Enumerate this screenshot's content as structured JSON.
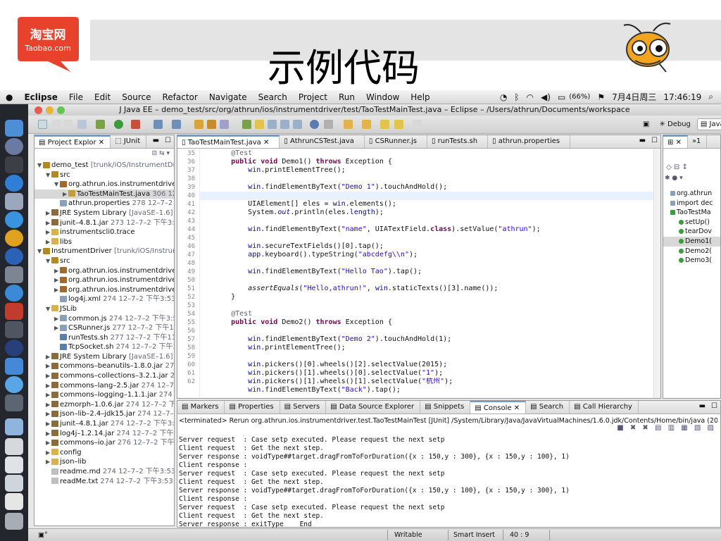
{
  "slide": {
    "title": "示例代码",
    "logo_cn": "淘宝网",
    "logo_en": "Taobao.com",
    "brand_color": "#e8412c"
  },
  "menubar": {
    "app": "Eclipse",
    "items": [
      "File",
      "Edit",
      "Source",
      "Refactor",
      "Navigate",
      "Search",
      "Project",
      "Run",
      "Window",
      "Help"
    ],
    "battery": "(66%)",
    "date": "7月4日周三",
    "time": "17:46:19"
  },
  "window": {
    "title": "J Java EE – demo_test/src/org/athrun/ios/instrumentdriver/test/TaoTestMainTest.java – Eclipse – /Users/athrun/Documents/workspace"
  },
  "perspectives": {
    "debug": "Debug",
    "javaee": "Java EE"
  },
  "explorer": {
    "tabs": [
      "Project Explor",
      "JUnit"
    ],
    "rows": [
      {
        "d": 0,
        "tw": "▼",
        "c": "#b48a1e",
        "t": "demo_test",
        "m": " [trunk/iOS/InstrumentDrive"
      },
      {
        "d": 1,
        "tw": "▼",
        "c": "#b48a1e",
        "t": "src",
        "m": ""
      },
      {
        "d": 2,
        "tw": "▼",
        "c": "#a06a2a",
        "t": "org.athrun.ios.instrumentdriver.t",
        "m": ""
      },
      {
        "d": 3,
        "tw": "▶",
        "c": "#c79b3a",
        "t": "TaoTestMainTest.java",
        "m": " 306  12",
        "sel": true
      },
      {
        "d": 2,
        "tw": "",
        "c": "#8aa0b8",
        "t": "athrun.properties",
        "m": " 278  12–7–2 T"
      },
      {
        "d": 1,
        "tw": "▶",
        "c": "#8b6b3a",
        "t": "JRE System Library",
        "m": " [JavaSE–1.6]"
      },
      {
        "d": 1,
        "tw": "▶",
        "c": "#8b6b3a",
        "t": "junit–4.8.1.jar",
        "m": " 273  12–7–2 下午3:4"
      },
      {
        "d": 1,
        "tw": "▶",
        "c": "#d9b24a",
        "t": "instrumentscli0.trace",
        "m": ""
      },
      {
        "d": 1,
        "tw": "▶",
        "c": "#d9b24a",
        "t": "libs",
        "m": ""
      },
      {
        "d": 0,
        "tw": "▼",
        "c": "#b48a1e",
        "t": "InstrumentDriver",
        "m": " [trunk/iOS/Instrumen"
      },
      {
        "d": 1,
        "tw": "▼",
        "c": "#b48a1e",
        "t": "src",
        "m": ""
      },
      {
        "d": 2,
        "tw": "▶",
        "c": "#a06a2a",
        "t": "org.athrun.ios.instrumentdriver",
        "m": ""
      },
      {
        "d": 2,
        "tw": "▶",
        "c": "#a06a2a",
        "t": "org.athrun.ios.instrumentdriver.c",
        "m": ""
      },
      {
        "d": 2,
        "tw": "▶",
        "c": "#a06a2a",
        "t": "org.athrun.ios.instrumentdriver.t",
        "m": ""
      },
      {
        "d": 2,
        "tw": "",
        "c": "#8aa0b8",
        "t": "log4j.xml",
        "m": " 274  12–7–2 下午3:53"
      },
      {
        "d": 1,
        "tw": "▼",
        "c": "#d9b24a",
        "t": "JSLib",
        "m": ""
      },
      {
        "d": 2,
        "tw": "▶",
        "c": "#8aa0b8",
        "t": "common.js",
        "m": " 274  12–7–2 下午3:5"
      },
      {
        "d": 2,
        "tw": "▶",
        "c": "#8aa0b8",
        "t": "CSRunner.js",
        "m": " 277  12–7–2 下午11"
      },
      {
        "d": 2,
        "tw": "",
        "c": "#5c7fa8",
        "t": "runTests.sh",
        "m": " 277  12–7–2 下午11:"
      },
      {
        "d": 2,
        "tw": "",
        "c": "#5c7fa8",
        "t": "TcpSocket.sh",
        "m": " 274  12–7–2 下午3"
      },
      {
        "d": 1,
        "tw": "▶",
        "c": "#8b6b3a",
        "t": "JRE System Library",
        "m": " [JavaSE–1.6]"
      },
      {
        "d": 1,
        "tw": "▶",
        "c": "#8b6b3a",
        "t": "commons–beanutils–1.8.0.jar",
        "m": " 274"
      },
      {
        "d": 1,
        "tw": "▶",
        "c": "#8b6b3a",
        "t": "commons–collections–3.2.1.jar",
        "m": " 274"
      },
      {
        "d": 1,
        "tw": "▶",
        "c": "#8b6b3a",
        "t": "commons–lang–2.5.jar",
        "m": " 274  12–7–2"
      },
      {
        "d": 1,
        "tw": "▶",
        "c": "#8b6b3a",
        "t": "commons–logging–1.1.1.jar",
        "m": " 274  12"
      },
      {
        "d": 1,
        "tw": "▶",
        "c": "#8b6b3a",
        "t": "ezmorph–1.0.6.jar",
        "m": " 274  12–7–2 下午"
      },
      {
        "d": 1,
        "tw": "▶",
        "c": "#8b6b3a",
        "t": "json–lib–2.4–jdk15.jar",
        "m": " 274  12–7–2"
      },
      {
        "d": 1,
        "tw": "▶",
        "c": "#8b6b3a",
        "t": "junit–4.8.1.jar",
        "m": " 274  12–7–2 下午3:5"
      },
      {
        "d": 1,
        "tw": "▶",
        "c": "#8b6b3a",
        "t": "log4j–1.2.14.jar",
        "m": " 274  12–7–2 下午3"
      },
      {
        "d": 1,
        "tw": "▶",
        "c": "#8b6b3a",
        "t": "commons–io.jar",
        "m": " 276  12–7–2 下午6:"
      },
      {
        "d": 1,
        "tw": "▶",
        "c": "#d9b24a",
        "t": "config",
        "m": ""
      },
      {
        "d": 1,
        "tw": "▶",
        "c": "#d9b24a",
        "t": "json–lib",
        "m": ""
      },
      {
        "d": 1,
        "tw": "",
        "c": "#bfbfbf",
        "t": "readme.md",
        "m": " 274  12–7–2 下午3:53  t"
      },
      {
        "d": 1,
        "tw": "",
        "c": "#bfbfbf",
        "t": "readMe.txt",
        "m": " 274  12–7–2 下午3:53  t"
      }
    ]
  },
  "editor": {
    "tabs": [
      "TaoTestMainTest.java",
      "AthrunCSTest.java",
      "CSRunner.js",
      "runTests.sh",
      "athrun.properties"
    ],
    "line_numbers": [
      "35",
      "36",
      "37",
      "38",
      "39",
      "40",
      "41",
      "42",
      "43",
      "44",
      "45",
      "46",
      "47",
      "48",
      "49",
      "50",
      "51",
      "52",
      "53",
      "54",
      "55",
      "56",
      "57",
      "58",
      "59",
      "60",
      "61",
      "62",
      ""
    ],
    "lines": [
      [
        [
          "an",
          "    @Test"
        ]
      ],
      [
        [
          "kw",
          "    public void "
        ],
        [
          "",
          "Demo1() "
        ],
        [
          "kw",
          "throws "
        ],
        [
          "",
          "Exception {"
        ]
      ],
      [
        [
          "",
          "        "
        ],
        [
          "fd",
          "win"
        ],
        [
          "",
          ".printElementTree();"
        ]
      ],
      [
        [
          "",
          ""
        ]
      ],
      [
        [
          "",
          "        "
        ],
        [
          "fd",
          "win"
        ],
        [
          "",
          ".findElementByText("
        ],
        [
          "st",
          "\"Demo 1\""
        ],
        [
          "",
          ").touchAndHold();"
        ]
      ],
      [
        [
          "",
          ""
        ]
      ],
      [
        [
          "",
          "        UIAElement[] eles = "
        ],
        [
          "fd",
          "win"
        ],
        [
          "",
          ".elements();"
        ]
      ],
      [
        [
          "",
          "        System."
        ],
        [
          "fd it",
          "out"
        ],
        [
          "",
          ".println(eles."
        ],
        [
          "fd",
          "length"
        ],
        [
          "",
          ");"
        ]
      ],
      [
        [
          "",
          ""
        ]
      ],
      [
        [
          "",
          "        "
        ],
        [
          "fd",
          "win"
        ],
        [
          "",
          ".findElementByText("
        ],
        [
          "st",
          "\"name\""
        ],
        [
          "",
          ", UIATextField."
        ],
        [
          "kw",
          "class"
        ],
        [
          "",
          ").setValue("
        ],
        [
          "st",
          "\"athrun\""
        ],
        [
          "",
          ");"
        ]
      ],
      [
        [
          "",
          ""
        ]
      ],
      [
        [
          "",
          "        "
        ],
        [
          "fd",
          "win"
        ],
        [
          "",
          ".secureTextFields()[0].tap();"
        ]
      ],
      [
        [
          "",
          "        "
        ],
        [
          "fd",
          "app"
        ],
        [
          "",
          ".keyboard().typeString("
        ],
        [
          "st",
          "\"abcdefg\\\\n\""
        ],
        [
          "",
          ");"
        ]
      ],
      [
        [
          "",
          ""
        ]
      ],
      [
        [
          "",
          "        "
        ],
        [
          "fd",
          "win"
        ],
        [
          "",
          ".findElementByText("
        ],
        [
          "st",
          "\"Hello Tao\""
        ],
        [
          "",
          ").tap();"
        ]
      ],
      [
        [
          "",
          ""
        ]
      ],
      [
        [
          "it",
          "        assertEquals"
        ],
        [
          "",
          "("
        ],
        [
          "st",
          "\"Hello,athrun!\""
        ],
        [
          "",
          ", "
        ],
        [
          "fd",
          "win"
        ],
        [
          "",
          ".staticTexts()[3].name());"
        ]
      ],
      [
        [
          "",
          "    }"
        ]
      ],
      [
        [
          "",
          ""
        ]
      ],
      [
        [
          "an",
          "    @Test"
        ]
      ],
      [
        [
          "kw",
          "    public void "
        ],
        [
          "",
          "Demo2() "
        ],
        [
          "kw",
          "throws "
        ],
        [
          "",
          "Exception {"
        ]
      ],
      [
        [
          "",
          ""
        ]
      ],
      [
        [
          "",
          "        "
        ],
        [
          "fd",
          "win"
        ],
        [
          "",
          ".findElementByText("
        ],
        [
          "st",
          "\"Demo 2\""
        ],
        [
          "",
          ").touchAndHold(1);"
        ]
      ],
      [
        [
          "",
          "        "
        ],
        [
          "fd",
          "win"
        ],
        [
          "",
          ".printElementTree();"
        ]
      ],
      [
        [
          "",
          ""
        ]
      ],
      [
        [
          "",
          "        "
        ],
        [
          "fd",
          "win"
        ],
        [
          "",
          ".pickers()[0].wheels()[2].selectValue(2015);"
        ]
      ],
      [
        [
          "",
          "        "
        ],
        [
          "fd",
          "win"
        ],
        [
          "",
          ".pickers()[1].wheels()[0].selectValue("
        ],
        [
          "st",
          "\"1\""
        ],
        [
          "",
          ");"
        ]
      ],
      [
        [
          "",
          "        "
        ],
        [
          "fd",
          "win"
        ],
        [
          "",
          ".pickers()[1].wheels()[1].selectValue("
        ],
        [
          "st",
          "\"杭州\""
        ],
        [
          "",
          ");"
        ]
      ],
      [
        [
          "",
          "        "
        ],
        [
          "fd",
          "win"
        ],
        [
          "",
          ".findElementByText("
        ],
        [
          "st",
          "\"Back\""
        ],
        [
          "",
          ").tap();"
        ]
      ]
    ]
  },
  "outline": {
    "items": [
      "org.athrun",
      "import dec",
      "TaoTestMa",
      "setUp()",
      "tearDov",
      "Demo1(",
      "Demo2(",
      "Demo3("
    ]
  },
  "console": {
    "tabs": [
      "Markers",
      "Properties",
      "Servers",
      "Data Source Explorer",
      "Snippets",
      "Console",
      "Search",
      "Call Hierarchy"
    ],
    "terminated": "<terminated> Rerun org.athrun.ios.instrumentdriver.test.TaoTestMainTest [JUnit] /System/Library/Java/JavaVirtualMachines/1.6.0.jdk/Contents/Home/bin/java (2012–7–4 下午5:",
    "lines": [
      "Server request  : Case setp executed. Please request the next setp",
      "Client request  : Get the next step.",
      "Server response : voidType##target.dragFromToForDuration({x : 150,y : 300}, {x : 150,y : 100}, 1)",
      "Client response :",
      "Server request  : Case setp executed. Please request the next setp",
      "Client request  : Get the next step.",
      "Server response : voidType##target.dragFromToForDuration({x : 150,y : 100}, {x : 150,y : 300}, 1)",
      "Client response :",
      "Server request  : Case setp executed. Please request the next setp",
      "Client request  : Get the next step.",
      "Server response : exitType    End"
    ]
  },
  "status": {
    "writable": "Writable",
    "insert": "Smart Insert",
    "position": "40 : 9"
  }
}
